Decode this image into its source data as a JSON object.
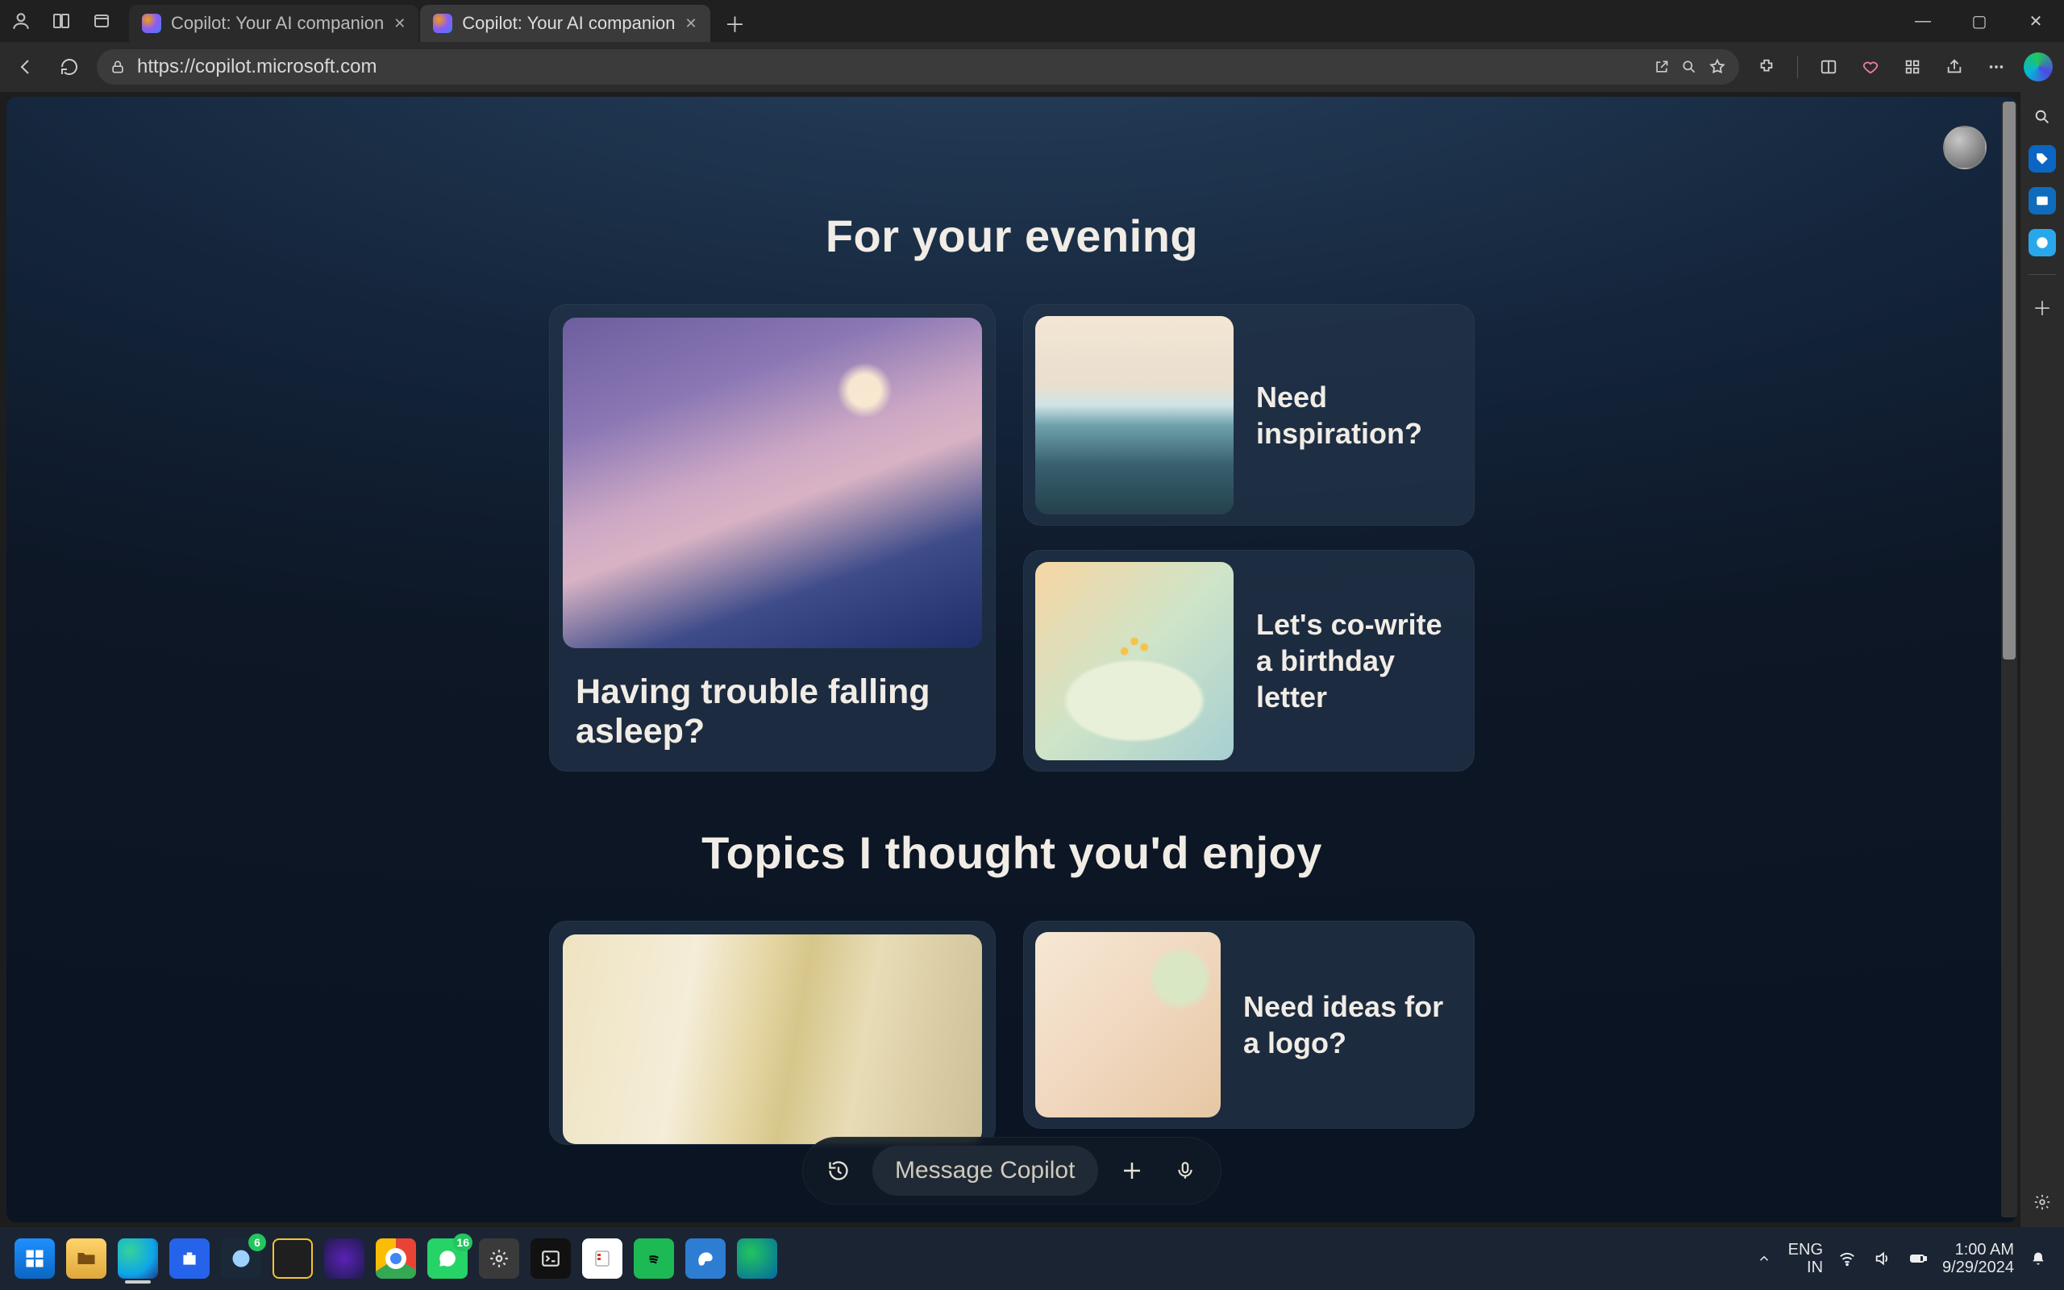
{
  "window": {
    "tabs": [
      {
        "title": "Copilot: Your AI companion",
        "active": false
      },
      {
        "title": "Copilot: Your AI companion",
        "active": true
      }
    ],
    "controls": {
      "minimize": "—",
      "maximize": "▢",
      "close": "✕"
    }
  },
  "toolbar": {
    "url_display": "https://copilot.microsoft.com"
  },
  "page": {
    "sections": [
      {
        "title": "For your evening",
        "large_card": {
          "title": "Having trouble falling asleep?",
          "image": "bed-illustration"
        },
        "small_cards": [
          {
            "title": "Need inspiration?",
            "image": "sea-horizon-illustration"
          },
          {
            "title": "Let's co-write a birthday letter",
            "image": "birthday-cake-illustration"
          }
        ]
      },
      {
        "title": "Topics I thought you'd enjoy",
        "large_card": {
          "title": "",
          "image": "curtain-light-illustration"
        },
        "small_cards": [
          {
            "title": "Need ideas for a logo?",
            "image": "laptop-desk-illustration"
          }
        ]
      }
    ],
    "chat": {
      "placeholder": "Message Copilot"
    }
  },
  "sidebar": {
    "items": [
      {
        "name": "search-icon"
      },
      {
        "name": "tag-icon"
      },
      {
        "name": "outlook-icon"
      },
      {
        "name": "skype-icon"
      }
    ]
  },
  "taskbar": {
    "apps": [
      {
        "name": "start"
      },
      {
        "name": "file-explorer"
      },
      {
        "name": "edge",
        "active": true
      },
      {
        "name": "microsoft-store"
      },
      {
        "name": "steam",
        "badge": "6"
      },
      {
        "name": "pycharm"
      },
      {
        "name": "media-player"
      },
      {
        "name": "chrome"
      },
      {
        "name": "whatsapp",
        "badge": "16"
      },
      {
        "name": "settings"
      },
      {
        "name": "terminal"
      },
      {
        "name": "character-map"
      },
      {
        "name": "spotify"
      },
      {
        "name": "paint"
      },
      {
        "name": "browser-globe"
      }
    ],
    "tray": {
      "language_top": "ENG",
      "language_bottom": "IN",
      "time": "1:00 AM",
      "date": "9/29/2024"
    }
  }
}
